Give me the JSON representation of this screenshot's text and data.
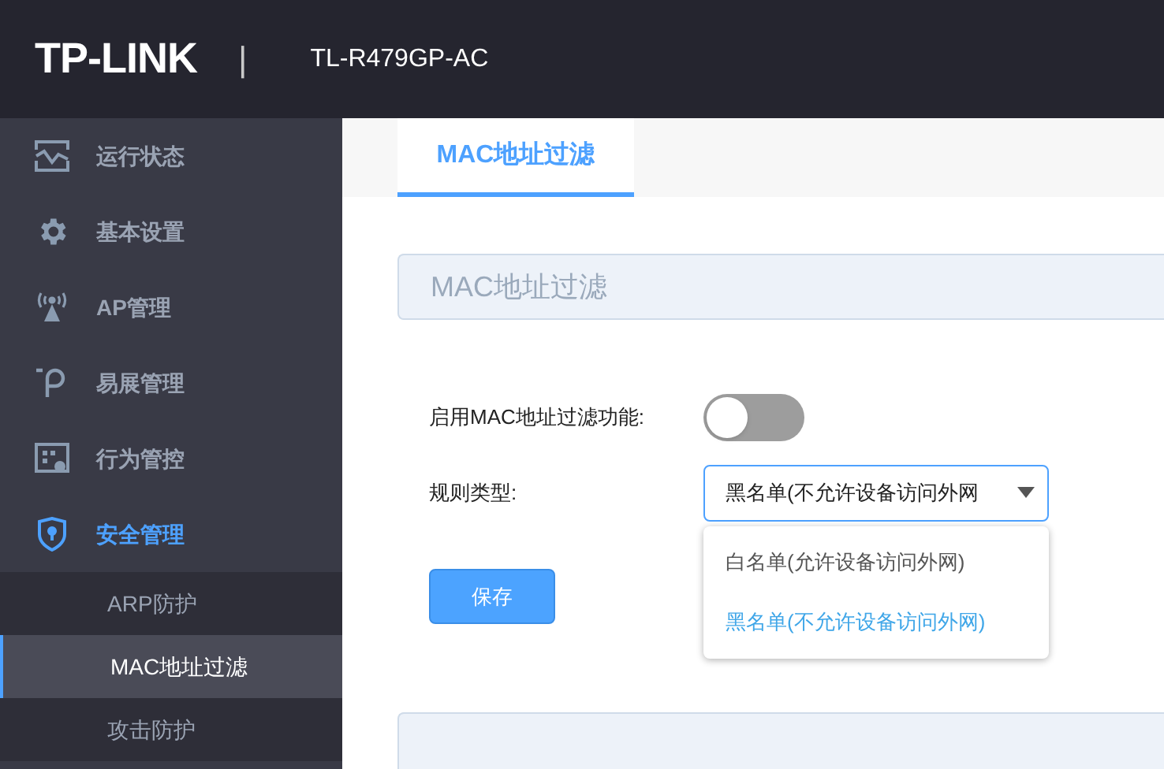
{
  "header": {
    "logo": "TP-LINK",
    "separator": "|",
    "model": "TL-R479GP-AC"
  },
  "sidebar": {
    "items": [
      {
        "kind": "chart",
        "label": "运行状态",
        "selected": false
      },
      {
        "kind": "gear",
        "label": "基本设置",
        "selected": false
      },
      {
        "kind": "ap",
        "label": "AP管理",
        "selected": false
      },
      {
        "kind": "p",
        "label": "易展管理",
        "selected": false
      },
      {
        "kind": "screen",
        "label": "行为管控",
        "selected": false
      },
      {
        "kind": "shield",
        "label": "安全管理",
        "selected": true,
        "expanded": true,
        "children": [
          {
            "label": "ARP防护",
            "selected": false
          },
          {
            "label": "MAC地址过滤",
            "selected": true
          },
          {
            "label": "攻击防护",
            "selected": false
          }
        ]
      }
    ]
  },
  "tabs": [
    {
      "label": "MAC地址过滤",
      "selected": true
    }
  ],
  "panel": {
    "title": "MAC地址过滤"
  },
  "form": {
    "toggle_label": "启用MAC地址过滤功能:",
    "toggle_on": false,
    "rule_label": "规则类型:",
    "rule_value": "黑名单(不允许设备访问外网",
    "dropdown_open": true,
    "options": [
      {
        "label": "白名单(允许设备访问外网)",
        "selected": false
      },
      {
        "label": "黑名单(不允许设备访问外网)",
        "selected": true
      }
    ],
    "save": "保存"
  }
}
